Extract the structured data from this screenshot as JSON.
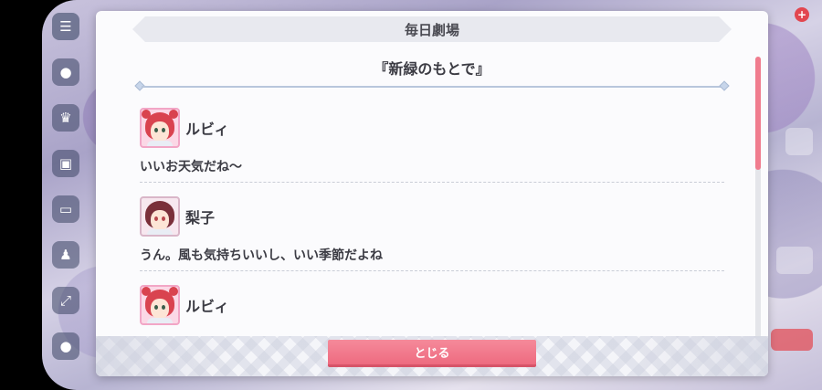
{
  "modal": {
    "title": "毎日劇場",
    "episode_title": "『新緑のもとで』",
    "close_label": "とじる"
  },
  "dialog": [
    {
      "speaker": "ルビィ",
      "avatar": "ruby-avatar-icon",
      "text": "いいお天気だね〜"
    },
    {
      "speaker": "梨子",
      "avatar": "riko-avatar-icon",
      "text": "うん。風も気持ちいいし、いい季節だよね"
    },
    {
      "speaker": "ルビィ",
      "avatar": "ruby-avatar-icon",
      "text": ""
    }
  ],
  "scroll": {
    "position": 0
  },
  "colors": {
    "accent": "#ee6b80",
    "scroll_thumb": "#f07c8e",
    "header_bg": "#e8e9ef",
    "text": "#3c3c44"
  }
}
